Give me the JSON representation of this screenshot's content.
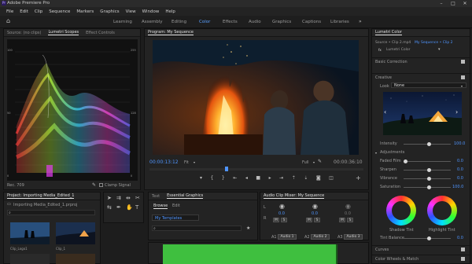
{
  "app_title": "Adobe Premiere Pro",
  "menu": [
    "File",
    "Edit",
    "Clip",
    "Sequence",
    "Markers",
    "Graphics",
    "View",
    "Window",
    "Help"
  ],
  "workspaces": [
    {
      "label": "Learning",
      "active": false
    },
    {
      "label": "Assembly",
      "active": false
    },
    {
      "label": "Editing",
      "active": false
    },
    {
      "label": "Color",
      "active": true
    },
    {
      "label": "Effects",
      "active": false
    },
    {
      "label": "Audio",
      "active": false
    },
    {
      "label": "Graphics",
      "active": false
    },
    {
      "label": "Captions",
      "active": false
    },
    {
      "label": "Libraries",
      "active": false
    }
  ],
  "source_panel": {
    "tabs": [
      "Source: (no clips)",
      "Lumetri Scopes",
      "Effect Controls"
    ],
    "scale_left": [
      "100",
      "90",
      "80",
      "70",
      "60",
      "50",
      "40",
      "30",
      "20",
      "10",
      "0"
    ],
    "scale_right": [
      "255",
      "230",
      "204",
      "178",
      "153",
      "128",
      "102",
      "76",
      "51",
      "26",
      "0"
    ],
    "footer_left": "Rec. 709",
    "footer_right": "Clamp Signal",
    "footer_bits": "8 Bit"
  },
  "program_monitor": {
    "title": "Program: My Sequence",
    "timecode_in": "00:00:13:12",
    "fit": "Fit",
    "quality": "Full",
    "timecode_out": "00:00:36:10"
  },
  "project_panel": {
    "title": "Project: Importing Media_Edited_1",
    "file": "Importing Media_Edited_1.prproj",
    "items": [
      "Clip_Logo1",
      "Clip_1"
    ]
  },
  "graphics_panel": {
    "tabs": [
      "Text",
      "Essential Graphics"
    ],
    "subtabs": [
      "Browse",
      "Edit"
    ],
    "dropdown": "My Templates"
  },
  "audio_mixer": {
    "title": "Audio Clip Mixer: My Sequence",
    "channels": [
      {
        "label": "A1",
        "name": "Audio 1",
        "value": "0.0"
      },
      {
        "label": "A2",
        "name": "Audio 2",
        "value": "0.0"
      },
      {
        "label": "A3",
        "name": "Audio 3",
        "value": "0.0"
      }
    ],
    "left_values": [
      "L",
      "R"
    ]
  },
  "lumetri": {
    "title": "Lumetri Color",
    "source_label": "Source • Clip 2.mp4",
    "sequence_label": "My Sequence • Clip 2",
    "effect_name": "Lumetri Color",
    "sections": [
      "Basic Correction",
      "Creative"
    ],
    "look_label": "Look",
    "look_value": "None",
    "intensity_label": "Intensity",
    "intensity_value": "100.0",
    "adjustments_label": "Adjustments",
    "sliders": [
      {
        "label": "Faded Film",
        "value": "0.0",
        "level": 0.0
      },
      {
        "label": "Sharpen",
        "value": "0.0",
        "level": 0.5
      },
      {
        "label": "Vibrance",
        "value": "0.0",
        "level": 0.5
      },
      {
        "label": "Saturation",
        "value": "100.0",
        "level": 0.5
      }
    ],
    "wheel_left": "Shadow Tint",
    "wheel_right": "Highlight Tint",
    "tint_balance_label": "Tint Balance",
    "tint_balance_value": "0.0",
    "bottom_sections": [
      "Curves",
      "Color Wheels & Match"
    ],
    "colors": {
      "accent": "#4f95ff",
      "panel": "#232323",
      "background": "#1d1d1d"
    }
  }
}
